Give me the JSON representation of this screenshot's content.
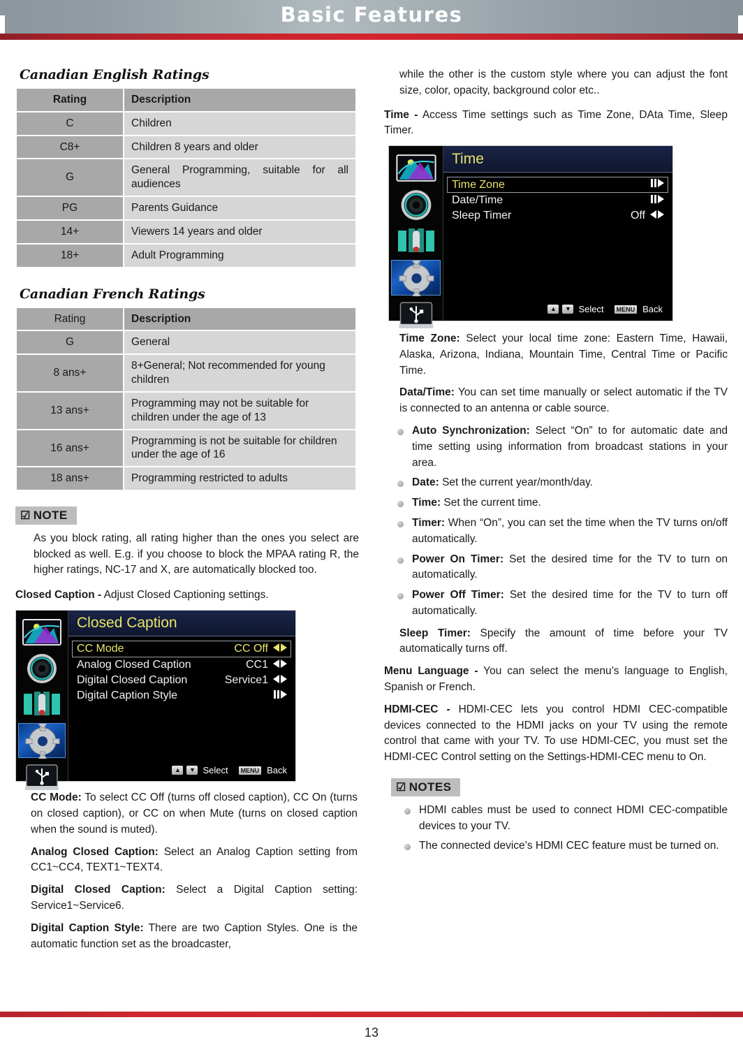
{
  "header": {
    "title": "Basic Features"
  },
  "footer": {
    "page_number": "13"
  },
  "accent_colors": {
    "header_rule_red": "#c8232c",
    "footer_rule_red": "#cf2731",
    "header_gray": "#99a4aa",
    "table_header_gray": "#a8a8a8",
    "table_rating_gray": "#a8a8a8",
    "table_desc_gray": "#d6d6d6",
    "note_tag_gray": "#bdbdbd",
    "osd_title_yellow": "#e8e46a",
    "osd_titlebar_navy": "#141d3a"
  },
  "left_column": {
    "english_table": {
      "title": "Canadian English Ratings",
      "headers": [
        "Rating",
        "Description"
      ],
      "rows": [
        [
          "C",
          "Children"
        ],
        [
          "C8+",
          "Children 8 years and older"
        ],
        [
          "G",
          "General Programming, suitable for all audiences"
        ],
        [
          "PG",
          "Parents Guidance"
        ],
        [
          "14+",
          "Viewers 14 years and older"
        ],
        [
          "18+",
          "Adult Programming"
        ]
      ]
    },
    "french_table": {
      "title": "Canadian French Ratings",
      "headers": [
        "Rating",
        "Description"
      ],
      "rows": [
        [
          "G",
          "General"
        ],
        [
          "8 ans+",
          "8+General; Not recommended for young children"
        ],
        [
          "13 ans+",
          "Programming may not be suitable for children under the age of 13"
        ],
        [
          "16 ans+",
          "Programming is not be suitable for children under the age of 16"
        ],
        [
          "18 ans+",
          "Programming restricted to adults"
        ]
      ]
    },
    "note": {
      "tag": "NOTE",
      "text": "As you block rating, all rating higher than the ones you select are blocked as well. E.g. if you choose to block the MPAA rating R, the higher ratings, NC-17 and X, are automatically blocked too."
    },
    "closed_caption_intro": {
      "bold": "Closed Caption -",
      "rest": " Adjust Closed Captioning settings."
    },
    "cc_osd": {
      "title": "Closed Caption",
      "rows": [
        {
          "label": "CC Mode",
          "value": "CC Off",
          "arrow": "lr",
          "active": true
        },
        {
          "label": "Analog Closed Caption",
          "value": "CC1",
          "arrow": "lr",
          "active": false
        },
        {
          "label": "Digital Closed Caption",
          "value": "Service1",
          "arrow": "lr",
          "active": false
        },
        {
          "label": "Digital Caption Style",
          "value": "",
          "arrow": "submenu",
          "active": false
        }
      ],
      "footer": {
        "select": "Select",
        "menu_key": "MENU",
        "back": "Back"
      },
      "sidebar_icons": [
        "picture-icon",
        "sound-icon",
        "channel-icon",
        "settings-icon",
        "usb-icon"
      ],
      "selected_sidebar_index": 3
    },
    "descriptions": [
      {
        "bold": "CC Mode:",
        "rest": " To select CC Off (turns off closed caption), CC On (turns on closed caption), or CC on when Mute (turns on closed caption when the sound is muted)."
      },
      {
        "bold": "Analog Closed Caption:",
        "rest": " Select an Analog Caption setting from CC1~CC4, TEXT1~TEXT4."
      },
      {
        "bold": "Digital Closed Caption:",
        "rest": " Select a Digital Caption setting: Service1~Service6."
      },
      {
        "bold": "Digital Caption Style:",
        "rest": " There are two Caption Styles. One is the automatic function set as the broadcaster,"
      }
    ]
  },
  "right_column": {
    "continuation": "while the other is the custom style where you can adjust the font size, color, opacity, background color etc..",
    "time_intro": {
      "bold": "Time -",
      "rest": " Access Time settings such as Time Zone, DAta Time, Sleep Timer."
    },
    "time_osd": {
      "title": "Time",
      "rows": [
        {
          "label": "Time Zone",
          "value": "",
          "arrow": "submenu",
          "active": true
        },
        {
          "label": "Date/Time",
          "value": "",
          "arrow": "submenu",
          "active": false
        },
        {
          "label": "Sleep Timer",
          "value": "Off",
          "arrow": "lr",
          "active": false
        }
      ],
      "footer": {
        "select": "Select",
        "menu_key": "MENU",
        "back": "Back"
      },
      "sidebar_icons": [
        "picture-icon",
        "sound-icon",
        "channel-icon",
        "settings-icon",
        "usb-icon"
      ],
      "selected_sidebar_index": 3
    },
    "time_zone": {
      "bold": "Time Zone:",
      "rest": " Select your local time zone: Eastern Time, Hawaii, Alaska, Arizona, Indiana, Mountain Time, Central Time or Pacific Time."
    },
    "data_time": {
      "bold": "Data/Time:",
      "rest": " You can set time manually or select automatic if the TV is connected to an antenna or cable source."
    },
    "data_time_bullets": [
      {
        "bold": "Auto Synchronization:",
        "rest": " Select “On” to for automatic date and time setting using information from broadcast stations in your area."
      },
      {
        "bold": "Date:",
        "rest": " Set the current year/month/day."
      },
      {
        "bold": "Time:",
        "rest": " Set the current time."
      },
      {
        "bold": "Timer:",
        "rest": " When “On”, you can set the time when the TV turns on/off automatically."
      },
      {
        "bold": "Power On Timer:",
        "rest": " Set the desired time for the TV to turn on automatically."
      },
      {
        "bold": "Power Off Timer:",
        "rest": " Set the desired time for the TV to turn off automatically."
      }
    ],
    "sleep_timer": {
      "bold": "Sleep Timer:",
      "rest": " Specify the amount of time before your TV automatically turns off."
    },
    "menu_language": {
      "bold": "Menu Language -",
      "rest": " You can select the menu’s language to English, Spanish or French."
    },
    "hdmi_cec": {
      "bold": "HDMI-CEC -",
      "rest": " HDMI-CEC lets you control HDMI CEC-compatible devices connected to the HDMI jacks on your TV using the remote control that came with your TV. To use HDMI-CEC, you must set the HDMI-CEC Control setting on the Settings-HDMI-CEC menu to On."
    },
    "notes": {
      "tag": "NOTES",
      "items": [
        "HDMI cables must be used to connect HDMI CEC-compatible devices to your TV.",
        "The connected device’s HDMI CEC feature must be turned on."
      ]
    }
  }
}
